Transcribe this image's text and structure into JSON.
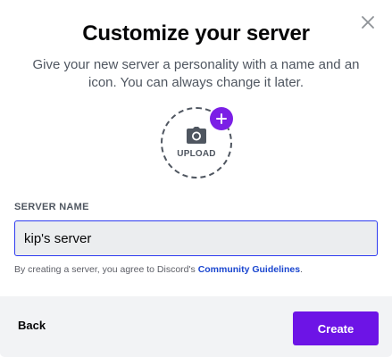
{
  "modal": {
    "title": "Customize your server",
    "subtitle": "Give your new server a personality with a name and an icon. You can always change it later.",
    "close_icon": "close-icon"
  },
  "upload": {
    "label": "UPLOAD",
    "camera_icon": "camera-icon",
    "plus_icon": "plus-icon"
  },
  "server_name": {
    "label": "SERVER NAME",
    "value": "kip's server"
  },
  "terms": {
    "prefix": "By creating a server, you agree to Discord's ",
    "link": "Community Guidelines",
    "suffix": "."
  },
  "footer": {
    "back_label": "Back",
    "create_label": "Create"
  },
  "colors": {
    "accent": "#6d14e6",
    "link": "#1a46cf",
    "footer_bg": "#f2f3f5"
  }
}
